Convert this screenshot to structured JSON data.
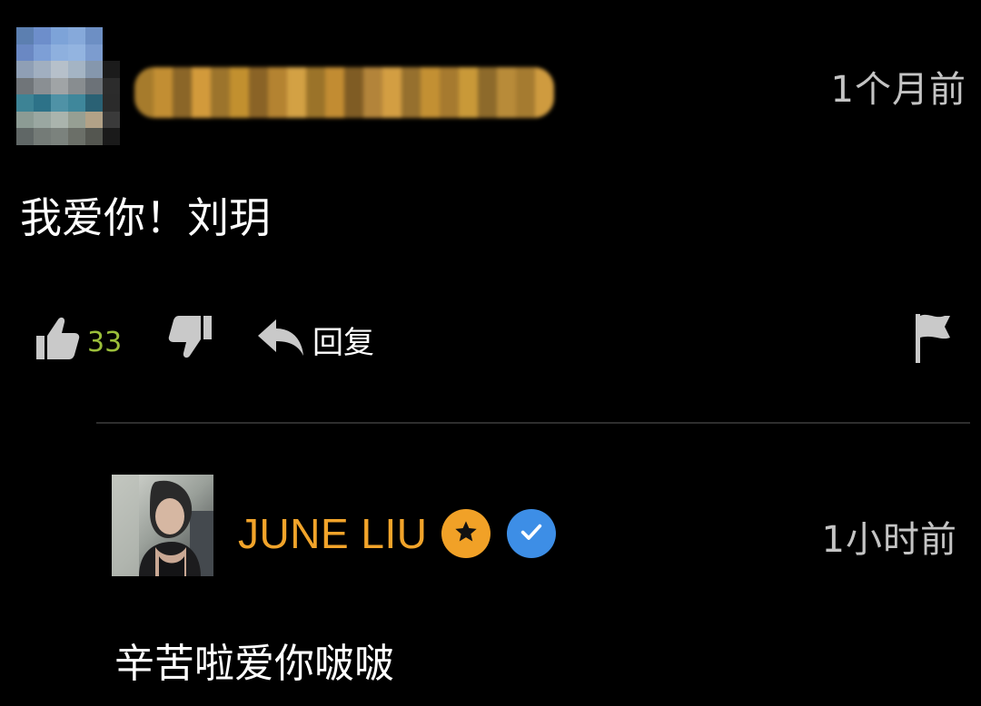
{
  "comment": {
    "timestamp": "1个月前",
    "text": "我爱你！刘玥",
    "likes": "33",
    "reply_label": "回复"
  },
  "reply": {
    "author": "JUNE LIU",
    "timestamp": "1小时前",
    "text": "辛苦啦爱你啵啵"
  },
  "colors": {
    "background": "#000000",
    "like_count": "#9bbf3a",
    "author_name": "#f2a42a",
    "star_badge": "#f1a127",
    "verified_badge": "#3d8ee6",
    "timestamp": "#c4c4c4"
  },
  "icons": {
    "like": "thumbs-up-icon",
    "dislike": "thumbs-down-icon",
    "reply": "reply-arrow-icon",
    "flag": "flag-icon",
    "star_badge": "star-icon",
    "verified_badge": "checkmark-icon"
  }
}
